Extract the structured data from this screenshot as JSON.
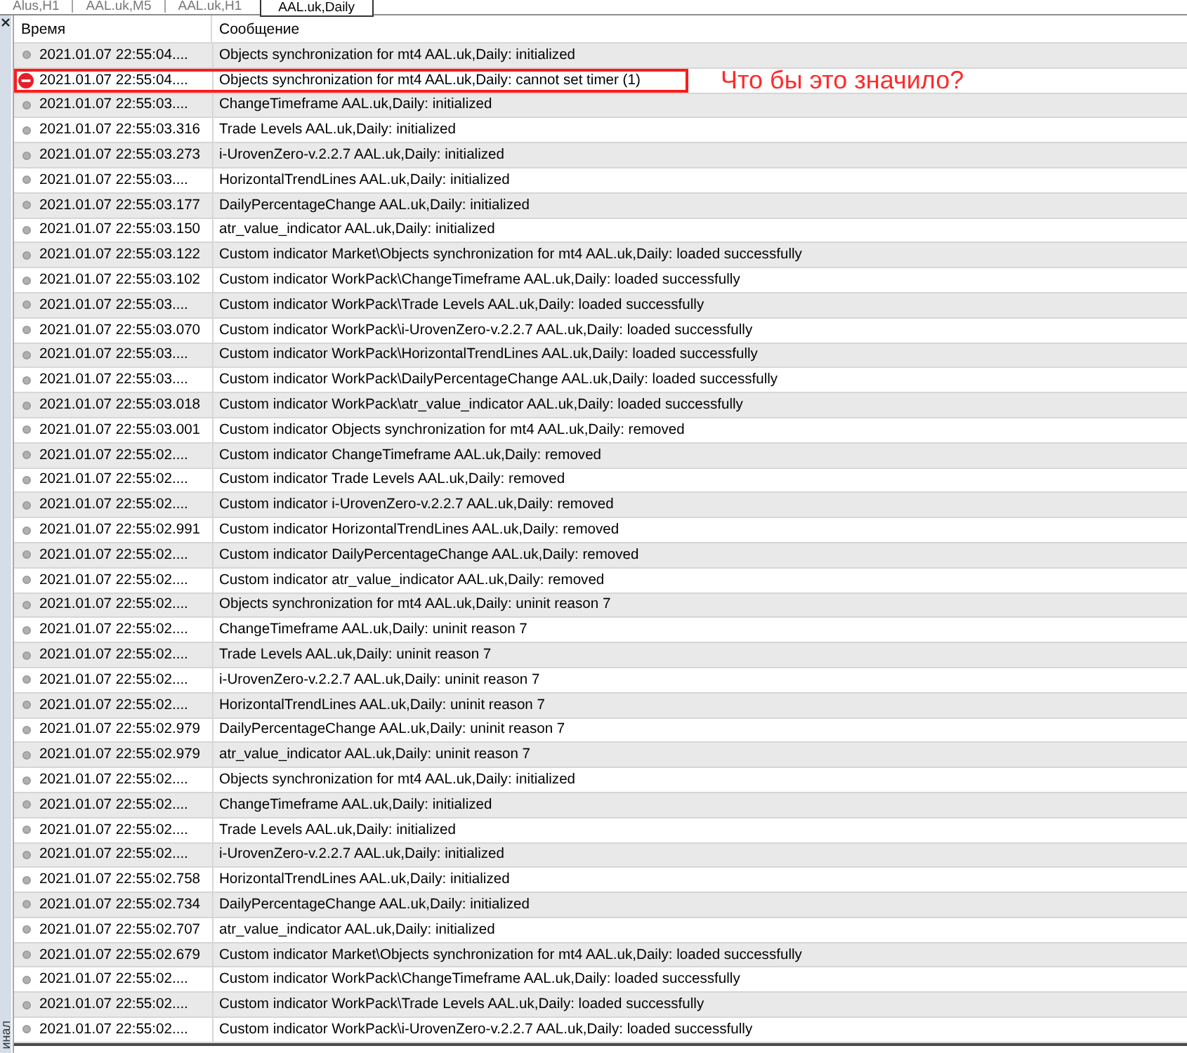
{
  "tabs": [
    {
      "label": "Alus,H1",
      "selected": false
    },
    {
      "label": "AAL.uk,M5",
      "selected": false
    },
    {
      "label": "AAL.uk,H1",
      "selected": false
    },
    {
      "label": "AAL.uk,Daily",
      "selected": true
    }
  ],
  "side_panel": {
    "title": "инал"
  },
  "annotation": {
    "text": "Что бы это значило?"
  },
  "table": {
    "columns": [
      "Время",
      "Сообщение"
    ],
    "rows": [
      {
        "kind": "info",
        "time": "2021.01.07 22:55:04....",
        "message": "Objects synchronization for mt4 AAL.uk,Daily: initialized",
        "highlighted": false
      },
      {
        "kind": "error",
        "time": "2021.01.07 22:55:04....",
        "message": "Objects synchronization for mt4 AAL.uk,Daily: cannot set timer (1)",
        "highlighted": true
      },
      {
        "kind": "info",
        "time": "2021.01.07 22:55:03....",
        "message": "ChangeTimeframe AAL.uk,Daily: initialized",
        "highlighted": false
      },
      {
        "kind": "info",
        "time": "2021.01.07 22:55:03.316",
        "message": "Trade Levels AAL.uk,Daily: initialized",
        "highlighted": false
      },
      {
        "kind": "info",
        "time": "2021.01.07 22:55:03.273",
        "message": "i-UrovenZero-v.2.2.7 AAL.uk,Daily: initialized",
        "highlighted": false
      },
      {
        "kind": "info",
        "time": "2021.01.07 22:55:03....",
        "message": "HorizontalTrendLines AAL.uk,Daily: initialized",
        "highlighted": false
      },
      {
        "kind": "info",
        "time": "2021.01.07 22:55:03.177",
        "message": "DailyPercentageChange AAL.uk,Daily: initialized",
        "highlighted": false
      },
      {
        "kind": "info",
        "time": "2021.01.07 22:55:03.150",
        "message": "atr_value_indicator AAL.uk,Daily: initialized",
        "highlighted": false
      },
      {
        "kind": "info",
        "time": "2021.01.07 22:55:03.122",
        "message": "Custom indicator Market\\Objects synchronization for mt4 AAL.uk,Daily: loaded successfully",
        "highlighted": false
      },
      {
        "kind": "info",
        "time": "2021.01.07 22:55:03.102",
        "message": "Custom indicator WorkPack\\ChangeTimeframe AAL.uk,Daily: loaded successfully",
        "highlighted": false
      },
      {
        "kind": "info",
        "time": "2021.01.07 22:55:03....",
        "message": "Custom indicator WorkPack\\Trade Levels AAL.uk,Daily: loaded successfully",
        "highlighted": false
      },
      {
        "kind": "info",
        "time": "2021.01.07 22:55:03.070",
        "message": "Custom indicator WorkPack\\i-UrovenZero-v.2.2.7 AAL.uk,Daily: loaded successfully",
        "highlighted": false
      },
      {
        "kind": "info",
        "time": "2021.01.07 22:55:03....",
        "message": "Custom indicator WorkPack\\HorizontalTrendLines AAL.uk,Daily: loaded successfully",
        "highlighted": false
      },
      {
        "kind": "info",
        "time": "2021.01.07 22:55:03....",
        "message": "Custom indicator WorkPack\\DailyPercentageChange AAL.uk,Daily: loaded successfully",
        "highlighted": false
      },
      {
        "kind": "info",
        "time": "2021.01.07 22:55:03.018",
        "message": "Custom indicator WorkPack\\atr_value_indicator AAL.uk,Daily: loaded successfully",
        "highlighted": false
      },
      {
        "kind": "info",
        "time": "2021.01.07 22:55:03.001",
        "message": "Custom indicator Objects synchronization for mt4 AAL.uk,Daily: removed",
        "highlighted": false
      },
      {
        "kind": "info",
        "time": "2021.01.07 22:55:02....",
        "message": "Custom indicator ChangeTimeframe AAL.uk,Daily: removed",
        "highlighted": false
      },
      {
        "kind": "info",
        "time": "2021.01.07 22:55:02....",
        "message": "Custom indicator Trade Levels AAL.uk,Daily: removed",
        "highlighted": false
      },
      {
        "kind": "info",
        "time": "2021.01.07 22:55:02....",
        "message": "Custom indicator i-UrovenZero-v.2.2.7 AAL.uk,Daily: removed",
        "highlighted": false
      },
      {
        "kind": "info",
        "time": "2021.01.07 22:55:02.991",
        "message": "Custom indicator HorizontalTrendLines AAL.uk,Daily: removed",
        "highlighted": false
      },
      {
        "kind": "info",
        "time": "2021.01.07 22:55:02....",
        "message": "Custom indicator DailyPercentageChange AAL.uk,Daily: removed",
        "highlighted": false
      },
      {
        "kind": "info",
        "time": "2021.01.07 22:55:02....",
        "message": "Custom indicator atr_value_indicator AAL.uk,Daily: removed",
        "highlighted": false
      },
      {
        "kind": "info",
        "time": "2021.01.07 22:55:02....",
        "message": "Objects synchronization for mt4 AAL.uk,Daily: uninit reason 7",
        "highlighted": false
      },
      {
        "kind": "info",
        "time": "2021.01.07 22:55:02....",
        "message": "ChangeTimeframe AAL.uk,Daily: uninit reason 7",
        "highlighted": false
      },
      {
        "kind": "info",
        "time": "2021.01.07 22:55:02....",
        "message": "Trade Levels AAL.uk,Daily: uninit reason 7",
        "highlighted": false
      },
      {
        "kind": "info",
        "time": "2021.01.07 22:55:02....",
        "message": "i-UrovenZero-v.2.2.7 AAL.uk,Daily: uninit reason 7",
        "highlighted": false
      },
      {
        "kind": "info",
        "time": "2021.01.07 22:55:02....",
        "message": "HorizontalTrendLines AAL.uk,Daily: uninit reason 7",
        "highlighted": false
      },
      {
        "kind": "info",
        "time": "2021.01.07 22:55:02.979",
        "message": "DailyPercentageChange AAL.uk,Daily: uninit reason 7",
        "highlighted": false
      },
      {
        "kind": "info",
        "time": "2021.01.07 22:55:02.979",
        "message": "atr_value_indicator AAL.uk,Daily: uninit reason 7",
        "highlighted": false
      },
      {
        "kind": "info",
        "time": "2021.01.07 22:55:02....",
        "message": "Objects synchronization for mt4 AAL.uk,Daily: initialized",
        "highlighted": false
      },
      {
        "kind": "info",
        "time": "2021.01.07 22:55:02....",
        "message": "ChangeTimeframe AAL.uk,Daily: initialized",
        "highlighted": false
      },
      {
        "kind": "info",
        "time": "2021.01.07 22:55:02....",
        "message": "Trade Levels AAL.uk,Daily: initialized",
        "highlighted": false
      },
      {
        "kind": "info",
        "time": "2021.01.07 22:55:02....",
        "message": "i-UrovenZero-v.2.2.7 AAL.uk,Daily: initialized",
        "highlighted": false
      },
      {
        "kind": "info",
        "time": "2021.01.07 22:55:02.758",
        "message": "HorizontalTrendLines AAL.uk,Daily: initialized",
        "highlighted": false
      },
      {
        "kind": "info",
        "time": "2021.01.07 22:55:02.734",
        "message": "DailyPercentageChange AAL.uk,Daily: initialized",
        "highlighted": false
      },
      {
        "kind": "info",
        "time": "2021.01.07 22:55:02.707",
        "message": "atr_value_indicator AAL.uk,Daily: initialized",
        "highlighted": false
      },
      {
        "kind": "info",
        "time": "2021.01.07 22:55:02.679",
        "message": "Custom indicator Market\\Objects synchronization for mt4 AAL.uk,Daily: loaded successfully",
        "highlighted": false
      },
      {
        "kind": "info",
        "time": "2021.01.07 22:55:02....",
        "message": "Custom indicator WorkPack\\ChangeTimeframe AAL.uk,Daily: loaded successfully",
        "highlighted": false
      },
      {
        "kind": "info",
        "time": "2021.01.07 22:55:02....",
        "message": "Custom indicator WorkPack\\Trade Levels AAL.uk,Daily: loaded successfully",
        "highlighted": false
      },
      {
        "kind": "info",
        "time": "2021.01.07 22:55:02....",
        "message": "Custom indicator WorkPack\\i-UrovenZero-v.2.2.7 AAL.uk,Daily: loaded successfully",
        "highlighted": false
      }
    ]
  }
}
